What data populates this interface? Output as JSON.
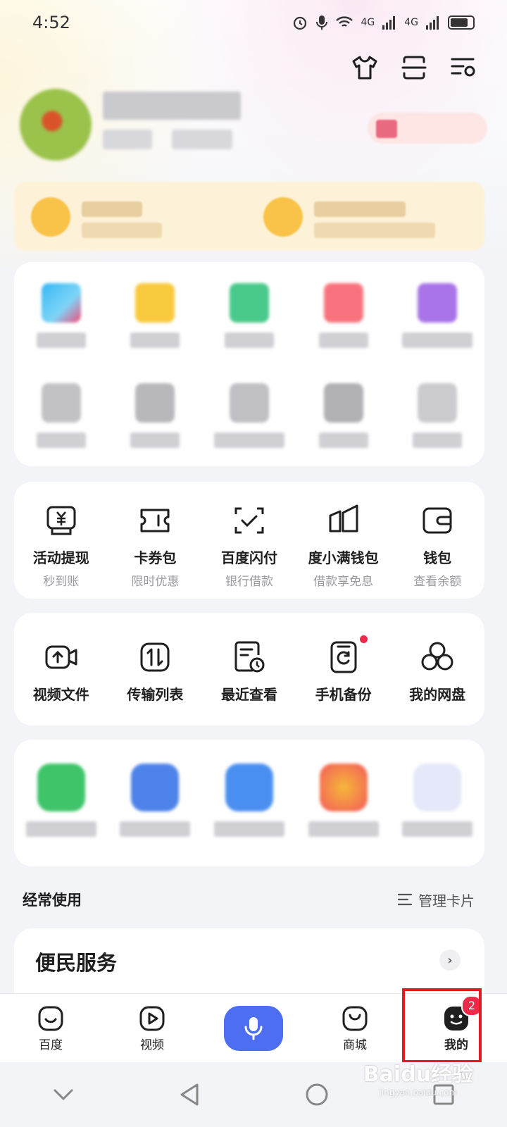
{
  "status_bar": {
    "time": "4:52",
    "signal_1": "4G",
    "signal_2": "4G"
  },
  "quick_tools": [
    {
      "name": "活动提现",
      "sub": "秒到账"
    },
    {
      "name": "卡券包",
      "sub": "限时优惠"
    },
    {
      "name": "百度闪付",
      "sub": "银行借款"
    },
    {
      "name": "度小满钱包",
      "sub": "借款享免息"
    },
    {
      "name": "钱包",
      "sub": "查看余额"
    }
  ],
  "disk_tools": [
    {
      "name": "视频文件"
    },
    {
      "name": "传输列表"
    },
    {
      "name": "最近查看"
    },
    {
      "name": "手机备份"
    },
    {
      "name": "我的网盘"
    }
  ],
  "frequent": {
    "title": "经常使用",
    "manage": "管理卡片"
  },
  "service": {
    "title": "便民服务"
  },
  "tabbar": {
    "home": "百度",
    "video": "视频",
    "mall": "商城",
    "mine": "我的",
    "mine_badge": "2"
  },
  "watermark": {
    "text": "Baidu经验",
    "sub": "jingyan.baidu.com"
  },
  "colors": {
    "accent": "#4e6ef2",
    "badge": "#f0284a",
    "highlight": "#e31b23"
  }
}
